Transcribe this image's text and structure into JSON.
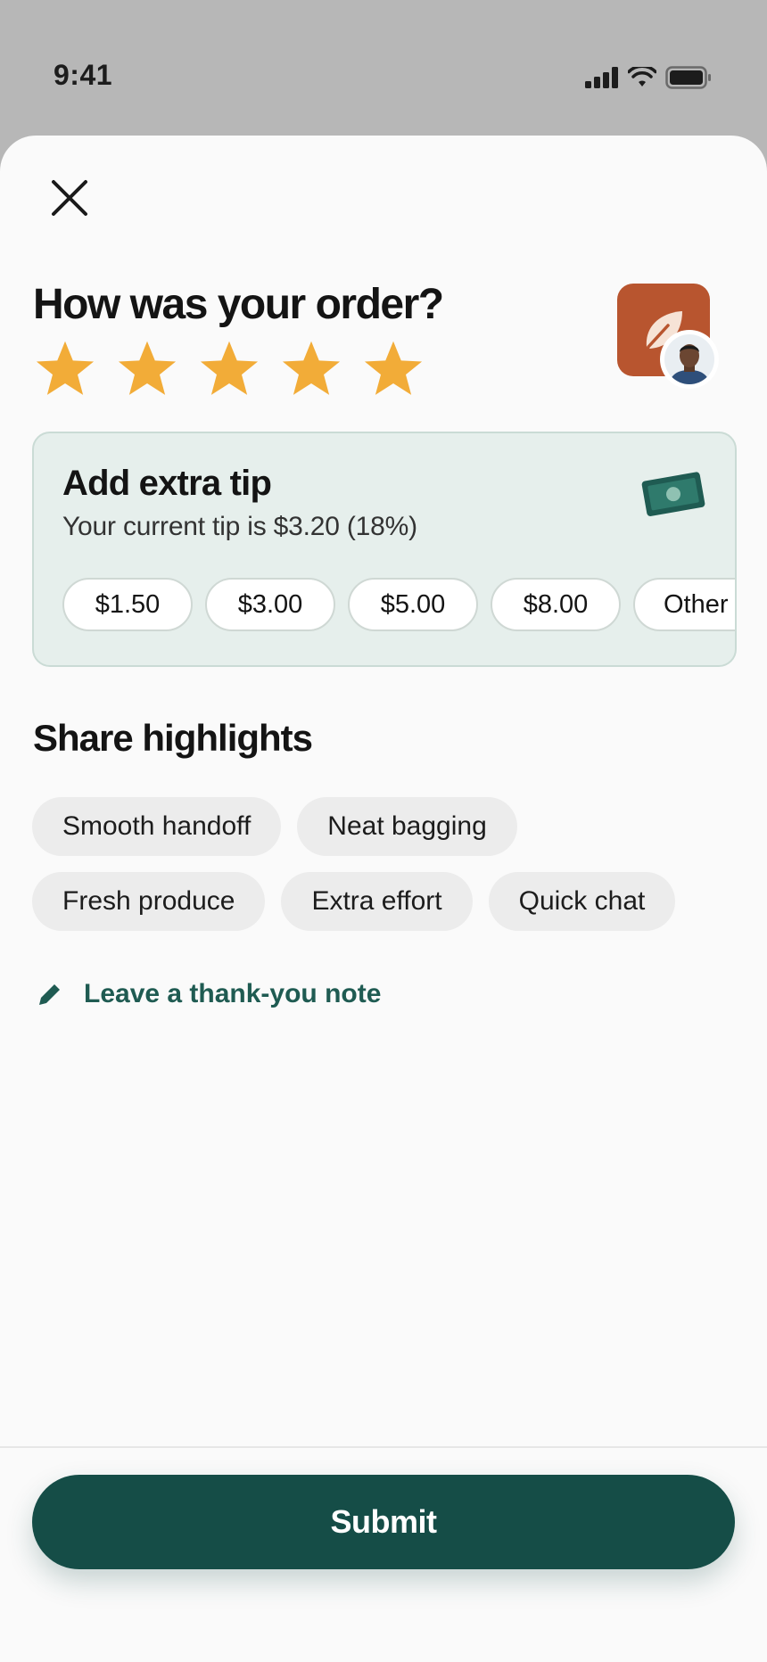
{
  "status_bar": {
    "time": "9:41"
  },
  "sheet": {
    "title": "How was your order?",
    "rating": {
      "value": 5,
      "max": 5,
      "star_color": "#f2ac38"
    },
    "store_badge_color": "#b8552f"
  },
  "tip": {
    "title": "Add extra tip",
    "subtitle": "Your current tip is $3.20 (18%)",
    "options": [
      "$1.50",
      "$3.00",
      "$5.00",
      "$8.00",
      "Other"
    ]
  },
  "highlights": {
    "title": "Share highlights",
    "chips": [
      "Smooth handoff",
      "Neat bagging",
      "Fresh produce",
      "Extra effort",
      "Quick chat"
    ]
  },
  "note": {
    "label": "Leave a thank-you note"
  },
  "submit": {
    "label": "Submit",
    "color": "#154d47"
  }
}
